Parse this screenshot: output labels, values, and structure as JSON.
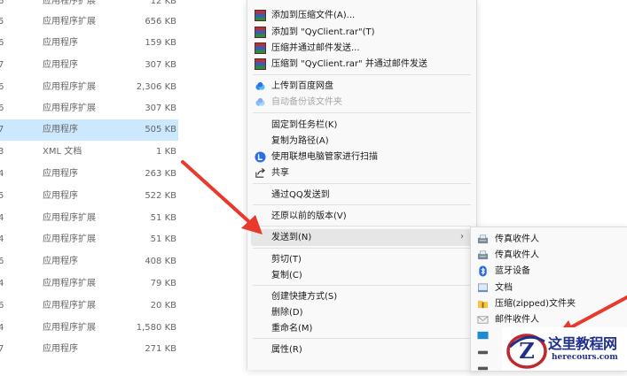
{
  "file_list": {
    "rows": [
      {
        "date": "6",
        "type": "应用程序扩展",
        "size": "12 KB"
      },
      {
        "date": "5",
        "type": "应用程序扩展",
        "size": "656 KB"
      },
      {
        "date": "6",
        "type": "应用程序",
        "size": "159 KB"
      },
      {
        "date": "7",
        "type": "应用程序",
        "size": "307 KB"
      },
      {
        "date": "6",
        "type": "应用程序扩展",
        "size": "2,306 KB"
      },
      {
        "date": "6",
        "type": "应用程序扩展",
        "size": "307 KB"
      },
      {
        "date": "7",
        "type": "应用程序",
        "size": "505 KB"
      },
      {
        "date": "3",
        "type": "XML 文档",
        "size": "1 KB"
      },
      {
        "date": "4",
        "type": "应用程序",
        "size": "263 KB"
      },
      {
        "date": "5",
        "type": "应用程序",
        "size": "522 KB"
      },
      {
        "date": "4",
        "type": "应用程序扩展",
        "size": "51 KB"
      },
      {
        "date": "4",
        "type": "应用程序扩展",
        "size": "51 KB"
      },
      {
        "date": "6",
        "type": "应用程序",
        "size": "408 KB"
      },
      {
        "date": "4",
        "type": "应用程序扩展",
        "size": "79 KB"
      },
      {
        "date": "6",
        "type": "应用程序扩展",
        "size": "20 KB"
      },
      {
        "date": "4",
        "type": "应用程序扩展",
        "size": "1,580 KB"
      },
      {
        "date": "7",
        "type": "应用程序",
        "size": "271 KB"
      }
    ]
  },
  "context_menu": {
    "items": [
      {
        "label": "添加到压缩文件(A)...",
        "icon": "winrar-icon",
        "disabled": false
      },
      {
        "label": "添加到 \"QyClient.rar\"(T)",
        "icon": "winrar-icon",
        "disabled": false
      },
      {
        "label": "压缩并通过邮件发送...",
        "icon": "winrar-icon",
        "disabled": false
      },
      {
        "label": "压缩到 \"QyClient.rar\" 并通过邮件发送",
        "icon": "winrar-icon",
        "disabled": false
      },
      {
        "label": "上传到百度网盘",
        "icon": "baidu-netdisk-icon",
        "disabled": false
      },
      {
        "label": "自动备份该文件夹",
        "icon": "baidu-netdisk-icon",
        "disabled": true
      },
      {
        "label": "固定到任务栏(K)",
        "icon": "",
        "disabled": false
      },
      {
        "label": "复制为路径(A)",
        "icon": "",
        "disabled": false
      },
      {
        "label": "使用联想电脑管家进行扫描",
        "icon": "lenovo-manager-icon",
        "disabled": false
      },
      {
        "label": "共享",
        "icon": "share-icon",
        "disabled": false
      },
      {
        "label": "通过QQ发送到",
        "icon": "",
        "disabled": false
      },
      {
        "label": "还原以前的版本(V)",
        "icon": "",
        "disabled": false
      },
      {
        "label": "发送到(N)",
        "icon": "",
        "disabled": false,
        "has_submenu": true,
        "arrow": "›"
      },
      {
        "label": "剪切(T)",
        "icon": "",
        "disabled": false
      },
      {
        "label": "复制(C)",
        "icon": "",
        "disabled": false
      },
      {
        "label": "创建快捷方式(S)",
        "icon": "",
        "disabled": false
      },
      {
        "label": "删除(D)",
        "icon": "",
        "disabled": false
      },
      {
        "label": "重命名(M)",
        "icon": "",
        "disabled": false
      },
      {
        "label": "属性(R)",
        "icon": "",
        "disabled": false
      }
    ]
  },
  "send_to_submenu": {
    "items": [
      {
        "label": "传真收件人",
        "icon": "fax-icon"
      },
      {
        "label": "传真收件人",
        "icon": "fax-icon"
      },
      {
        "label": "蓝牙设备",
        "icon": "bluetooth-icon"
      },
      {
        "label": "文档",
        "icon": "documents-icon"
      },
      {
        "label": "压缩(zipped)文件夹",
        "icon": "zip-folder-icon"
      },
      {
        "label": "邮件收件人",
        "icon": "mail-icon"
      },
      {
        "label": "",
        "icon": "desktop-icon"
      },
      {
        "label": "",
        "icon": "drive-icon"
      },
      {
        "label": "",
        "icon": "drive-icon"
      }
    ]
  },
  "watermark": {
    "title": "这里教程网",
    "url": "herecours.com",
    "logo_letter": "Z"
  },
  "colors": {
    "selection": "#cce8ff",
    "menu_bg": "#f9f9f9",
    "hover": "#e6e6e6",
    "arrow": "#e8392c",
    "watermark_blue": "#1f2f8e"
  }
}
